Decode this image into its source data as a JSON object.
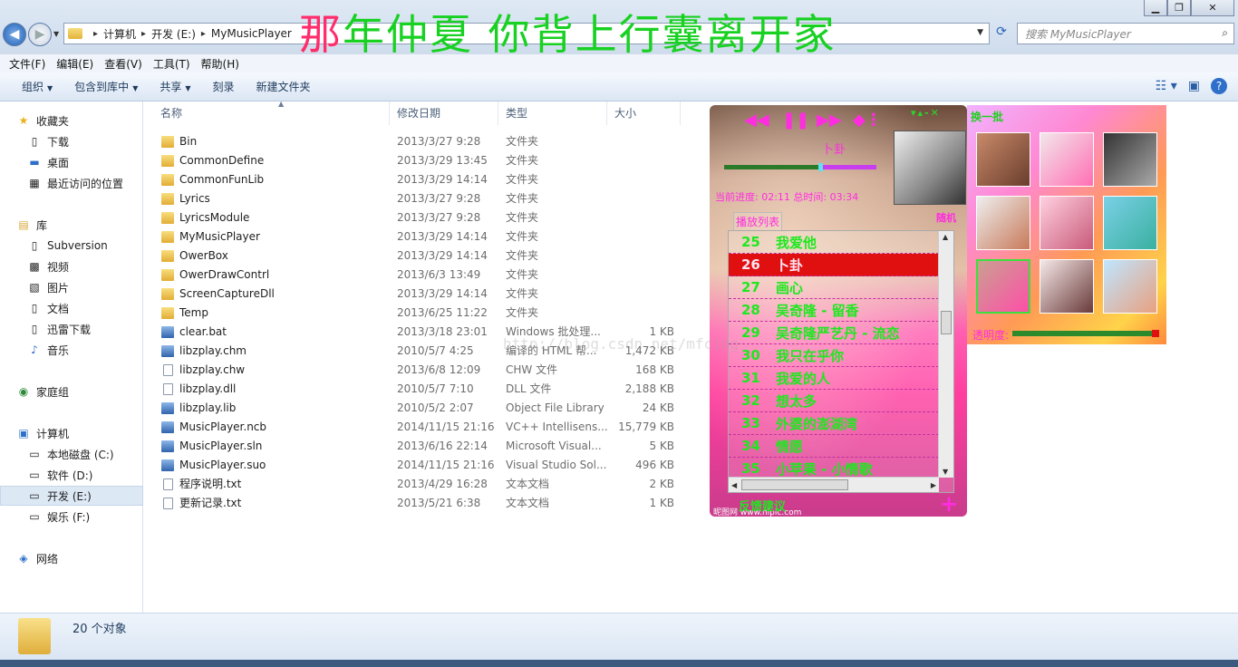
{
  "window": {
    "breadcrumbs": [
      "计算机",
      "开发 (E:)",
      "MyMusicPlayer"
    ],
    "search_placeholder": "搜索 MyMusicPlayer",
    "overlay_title_first": "那",
    "overlay_title_rest": "年仲夏 你背上行囊离开家"
  },
  "menu": [
    "文件(F)",
    "编辑(E)",
    "查看(V)",
    "工具(T)",
    "帮助(H)"
  ],
  "toolbar": {
    "organize": "组织",
    "include": "包含到库中",
    "share": "共享",
    "burn": "刻录",
    "new_folder": "新建文件夹"
  },
  "nav": {
    "favorites": "收藏夹",
    "downloads": "下载",
    "desktop": "桌面",
    "recent": "最近访问的位置",
    "libraries": "库",
    "subversion": "Subversion",
    "videos": "视频",
    "pictures": "图片",
    "documents": "文档",
    "xunlei": "迅雷下载",
    "music": "音乐",
    "homegroup": "家庭组",
    "computer": "计算机",
    "drive_c": "本地磁盘 (C:)",
    "drive_d": "软件 (D:)",
    "drive_e": "开发 (E:)",
    "drive_f": "娱乐 (F:)",
    "network": "网络"
  },
  "columns": {
    "name": "名称",
    "date": "修改日期",
    "type": "类型",
    "size": "大小"
  },
  "files": [
    {
      "name": "Bin",
      "date": "2013/3/27 9:28",
      "type": "文件夹",
      "size": "",
      "kind": "folder"
    },
    {
      "name": "CommonDefine",
      "date": "2013/3/29 13:45",
      "type": "文件夹",
      "size": "",
      "kind": "folder"
    },
    {
      "name": "CommonFunLib",
      "date": "2013/3/29 14:14",
      "type": "文件夹",
      "size": "",
      "kind": "folder"
    },
    {
      "name": "Lyrics",
      "date": "2013/3/27 9:28",
      "type": "文件夹",
      "size": "",
      "kind": "folder"
    },
    {
      "name": "LyricsModule",
      "date": "2013/3/27 9:28",
      "type": "文件夹",
      "size": "",
      "kind": "folder"
    },
    {
      "name": "MyMusicPlayer",
      "date": "2013/3/29 14:14",
      "type": "文件夹",
      "size": "",
      "kind": "folder"
    },
    {
      "name": "OwerBox",
      "date": "2013/3/29 14:14",
      "type": "文件夹",
      "size": "",
      "kind": "folder"
    },
    {
      "name": "OwerDrawContrl",
      "date": "2013/6/3 13:49",
      "type": "文件夹",
      "size": "",
      "kind": "folder"
    },
    {
      "name": "ScreenCaptureDll",
      "date": "2013/3/29 14:14",
      "type": "文件夹",
      "size": "",
      "kind": "folder"
    },
    {
      "name": "Temp",
      "date": "2013/6/25 11:22",
      "type": "文件夹",
      "size": "",
      "kind": "folder"
    },
    {
      "name": "clear.bat",
      "date": "2013/3/18 23:01",
      "type": "Windows 批处理...",
      "size": "1 KB",
      "kind": "app"
    },
    {
      "name": "libzplay.chm",
      "date": "2010/5/7 4:25",
      "type": "编译的 HTML 帮...",
      "size": "1,472 KB",
      "kind": "app"
    },
    {
      "name": "libzplay.chw",
      "date": "2013/6/8 12:09",
      "type": "CHW 文件",
      "size": "168 KB",
      "kind": "file"
    },
    {
      "name": "libzplay.dll",
      "date": "2010/5/7 7:10",
      "type": "DLL 文件",
      "size": "2,188 KB",
      "kind": "file"
    },
    {
      "name": "libzplay.lib",
      "date": "2010/5/2 2:07",
      "type": "Object File Library",
      "size": "24 KB",
      "kind": "app"
    },
    {
      "name": "MusicPlayer.ncb",
      "date": "2014/11/15 21:16",
      "type": "VC++ Intellisens...",
      "size": "15,779 KB",
      "kind": "app"
    },
    {
      "name": "MusicPlayer.sln",
      "date": "2013/6/16 22:14",
      "type": "Microsoft Visual...",
      "size": "5 KB",
      "kind": "app"
    },
    {
      "name": "MusicPlayer.suo",
      "date": "2014/11/15 21:16",
      "type": "Visual Studio Sol...",
      "size": "496 KB",
      "kind": "app"
    },
    {
      "name": "程序说明.txt",
      "date": "2013/4/29 16:28",
      "type": "文本文档",
      "size": "2 KB",
      "kind": "file"
    },
    {
      "name": "更新记录.txt",
      "date": "2013/5/21 6:38",
      "type": "文本文档",
      "size": "1 KB",
      "kind": "file"
    }
  ],
  "status": {
    "count": "20 个对象"
  },
  "player": {
    "current_song": "卜卦",
    "progress_fraction": 0.62,
    "times": "当前进度: 02:11   总时间: 03:34",
    "random": "随机",
    "playlist_label": "播放列表",
    "feedback": "反馈建议",
    "add": "+",
    "credit": "昵图网 www.nipic.com",
    "playlist": [
      {
        "num": "25",
        "title": "我爱他"
      },
      {
        "num": "26",
        "title": "卜卦",
        "playing": true
      },
      {
        "num": "27",
        "title": "画心"
      },
      {
        "num": "28",
        "title": "吴奇隆 - 留香"
      },
      {
        "num": "29",
        "title": "吴奇隆严艺丹 - 流恋"
      },
      {
        "num": "30",
        "title": "我只在乎你"
      },
      {
        "num": "31",
        "title": "我爱的人"
      },
      {
        "num": "32",
        "title": "想太多"
      },
      {
        "num": "33",
        "title": "外婆的澎湖湾"
      },
      {
        "num": "34",
        "title": "情愿"
      },
      {
        "num": "35",
        "title": "小苹果 - 小情歌"
      }
    ]
  },
  "skin": {
    "title": "换一批",
    "opacity_label": "透明度:",
    "opacity_fraction": 1.0
  },
  "watermark": "http://blog.csdn.net/mfcing"
}
